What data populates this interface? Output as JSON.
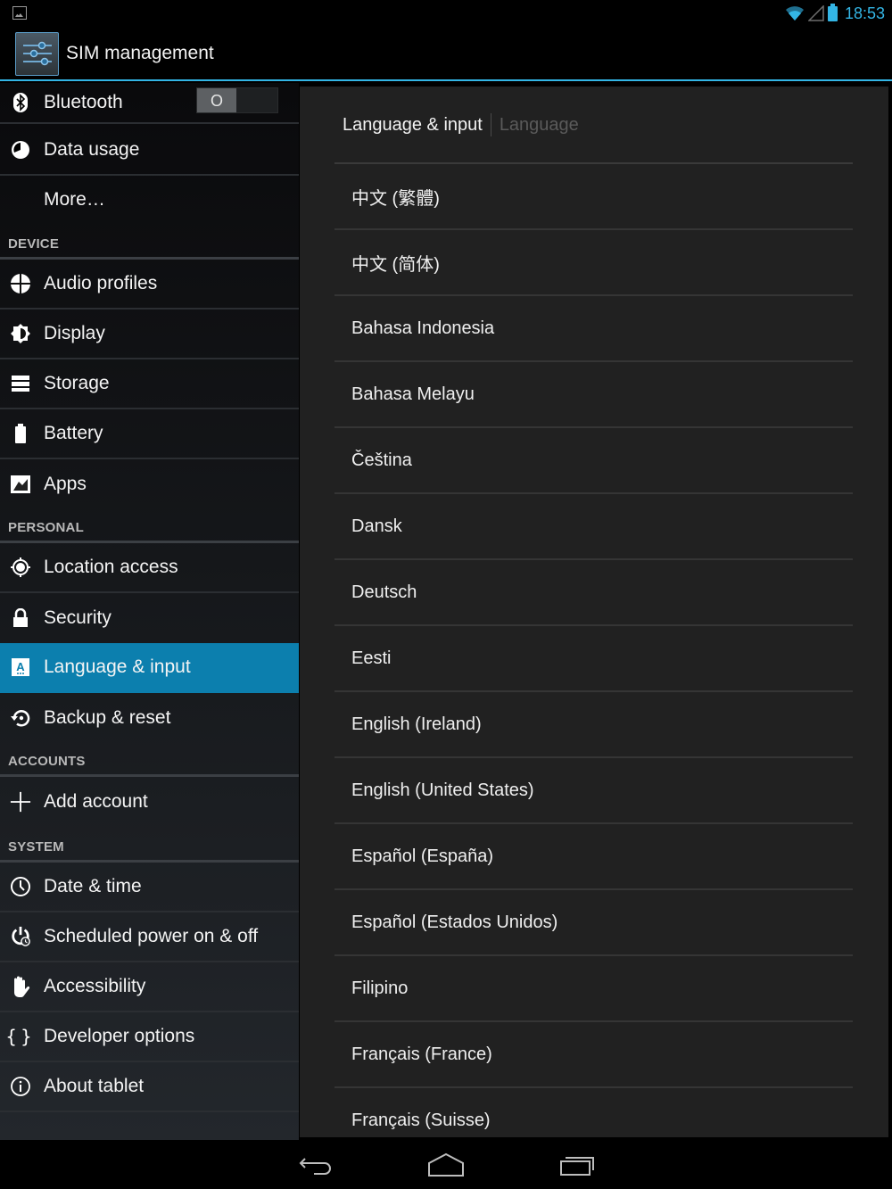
{
  "status_bar": {
    "time": "18:53",
    "icons": [
      "screenshot-notification-icon",
      "wifi-icon",
      "cell-signal-icon",
      "battery-icon"
    ],
    "accent_color": "#33b5e5"
  },
  "action_bar": {
    "title": "SIM management",
    "icon": "settings-sliders-icon"
  },
  "sidebar": {
    "top_items": [
      {
        "label": "Bluetooth",
        "icon": "bluetooth-icon",
        "toggle": "O"
      },
      {
        "label": "Data usage",
        "icon": "data-usage-icon"
      },
      {
        "label": "More…",
        "icon": ""
      }
    ],
    "sections": [
      {
        "header": "DEVICE",
        "items": [
          {
            "label": "Audio profiles",
            "icon": "audio-profiles-icon"
          },
          {
            "label": "Display",
            "icon": "display-icon"
          },
          {
            "label": "Storage",
            "icon": "storage-icon"
          },
          {
            "label": "Battery",
            "icon": "battery-icon"
          },
          {
            "label": "Apps",
            "icon": "apps-icon"
          }
        ]
      },
      {
        "header": "PERSONAL",
        "items": [
          {
            "label": "Location access",
            "icon": "location-icon"
          },
          {
            "label": "Security",
            "icon": "lock-icon"
          },
          {
            "label": "Language & input",
            "icon": "language-icon",
            "active": true
          },
          {
            "label": "Backup & reset",
            "icon": "backup-icon"
          }
        ]
      },
      {
        "header": "ACCOUNTS",
        "items": [
          {
            "label": "Add account",
            "icon": "plus-icon"
          }
        ]
      },
      {
        "header": "SYSTEM",
        "items": [
          {
            "label": "Date & time",
            "icon": "clock-icon"
          },
          {
            "label": "Scheduled power on & off",
            "icon": "scheduled-power-icon"
          },
          {
            "label": "Accessibility",
            "icon": "hand-icon"
          },
          {
            "label": "Developer options",
            "icon": "braces-icon"
          },
          {
            "label": "About tablet",
            "icon": "info-icon"
          }
        ]
      }
    ],
    "active_color": "#0c7fae"
  },
  "main": {
    "breadcrumb": {
      "parent": "Language & input",
      "current": "Language"
    },
    "languages": [
      "中文 (繁體)",
      "中文 (简体)",
      "Bahasa Indonesia",
      "Bahasa Melayu",
      "Čeština",
      "Dansk",
      "Deutsch",
      "Eesti",
      "English (Ireland)",
      "English (United States)",
      "Español (España)",
      "Español (Estados Unidos)",
      "Filipino",
      "Français (France)",
      "Français (Suisse)"
    ]
  },
  "nav_bar": {
    "buttons": [
      "back-icon",
      "home-icon",
      "recent-apps-icon"
    ]
  }
}
